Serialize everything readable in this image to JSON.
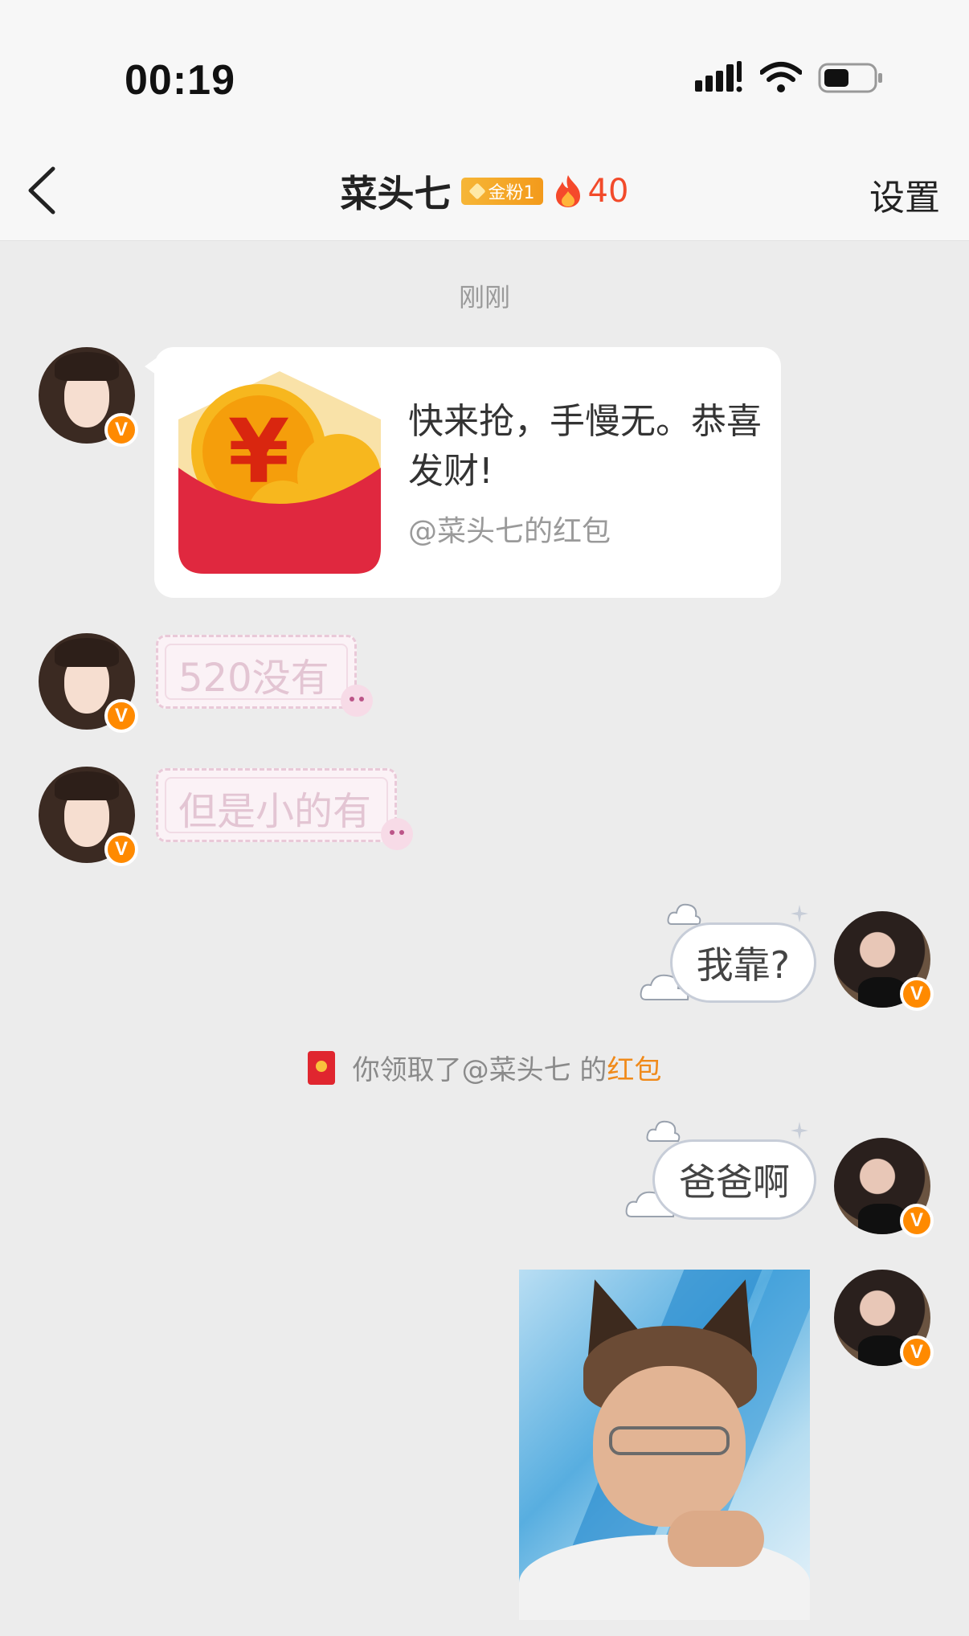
{
  "status_bar": {
    "time": "00:19"
  },
  "nav": {
    "back_label": "",
    "title": "菜头七",
    "fan_badge": "金粉1",
    "fire_count": "40",
    "settings_label": "设置"
  },
  "chat": {
    "timestamp": "刚刚",
    "red_packet": {
      "message": "快来抢，手慢无。恭喜发财!",
      "from": "@菜头七的红包"
    },
    "messages": [
      {
        "side": "left",
        "text": "520没有"
      },
      {
        "side": "left",
        "text": "但是小的有"
      },
      {
        "side": "right",
        "text": "我靠?"
      },
      {
        "side": "right",
        "text": "爸爸啊"
      }
    ],
    "system": {
      "prefix": "你领取了@菜头七 的",
      "highlight": "红包"
    }
  },
  "colors": {
    "accent_orange": "#f08a1a",
    "fire_red": "#f24a2a",
    "packet_red": "#e0262f",
    "verified_badge": "#ff8a00"
  },
  "icons": {
    "back": "chevron-left-icon",
    "fire": "fire-icon",
    "verified": "v-badge-icon",
    "signal": "signal-icon",
    "wifi": "wifi-icon",
    "battery": "battery-icon"
  }
}
